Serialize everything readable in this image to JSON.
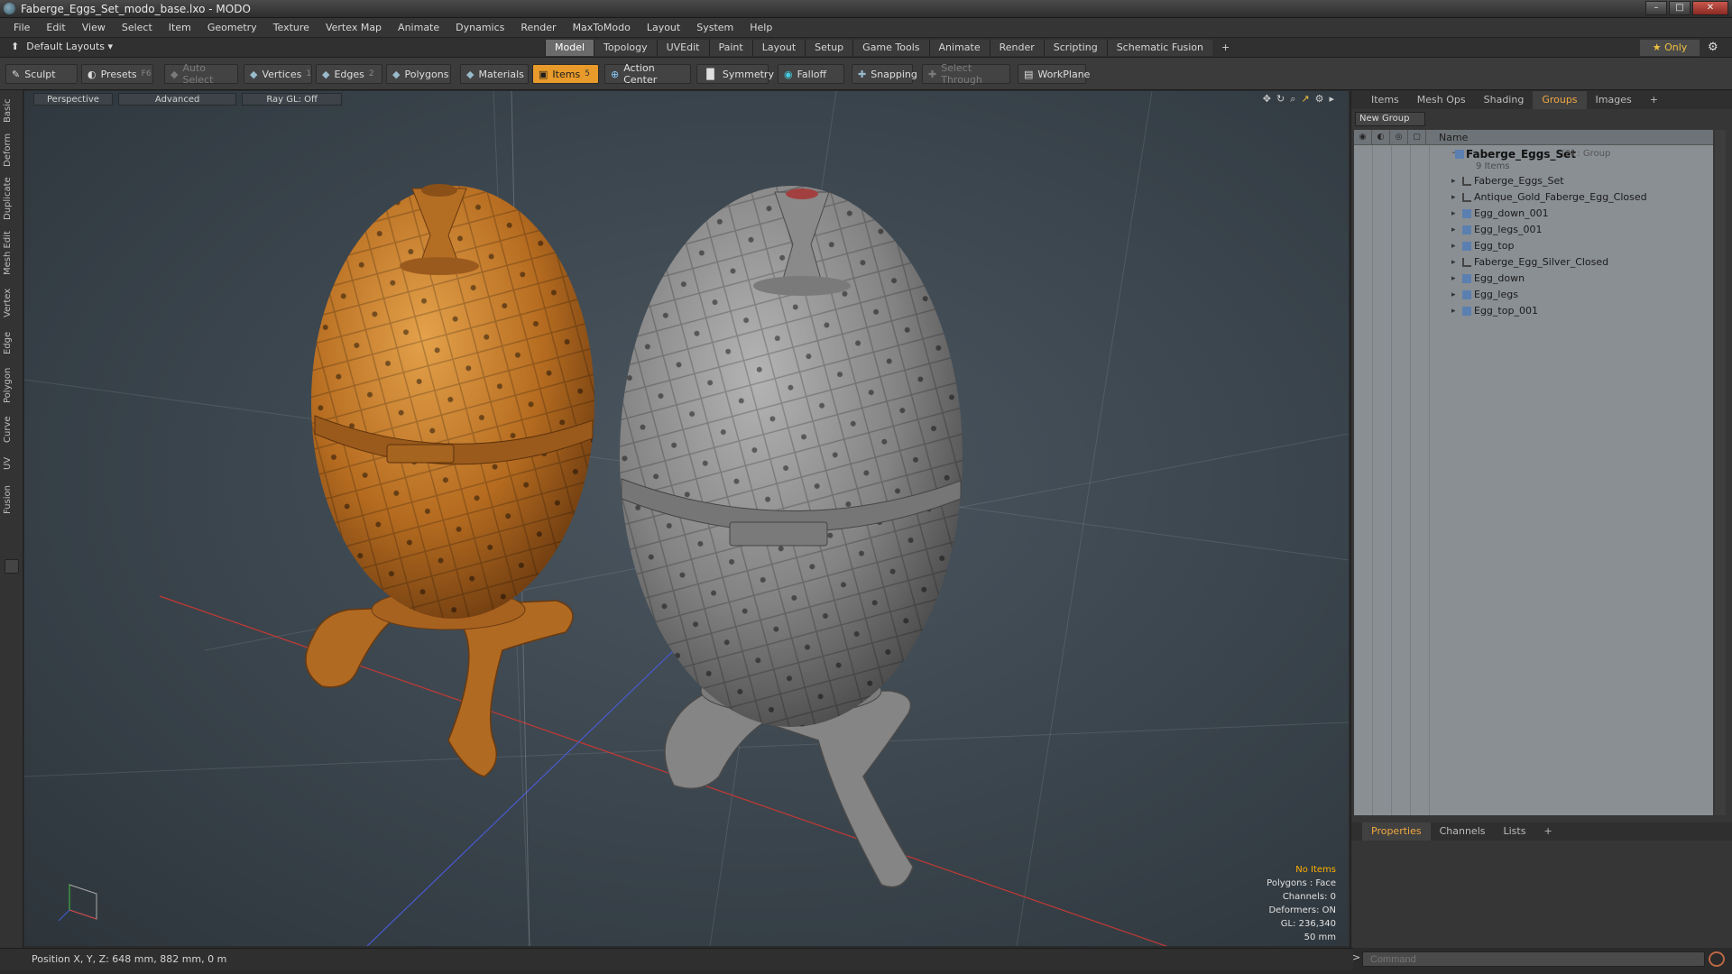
{
  "window": {
    "title": "Faberge_Eggs_Set_modo_base.lxo - MODO"
  },
  "menu": [
    "File",
    "Edit",
    "View",
    "Select",
    "Item",
    "Geometry",
    "Texture",
    "Vertex Map",
    "Animate",
    "Dynamics",
    "Render",
    "MaxToModo",
    "Layout",
    "System",
    "Help"
  ],
  "layout": {
    "selector": "Default Layouts ▾",
    "tabs": [
      "Model",
      "Topology",
      "UVEdit",
      "Paint",
      "Layout",
      "Setup",
      "Game Tools",
      "Animate",
      "Render",
      "Scripting",
      "Schematic Fusion"
    ],
    "active_tab": "Model",
    "add": "+",
    "only_label": "★ Only"
  },
  "toolbar": {
    "sculpt": "Sculpt",
    "presets": "Presets",
    "presets_key": "F6",
    "auto_select": "Auto Select",
    "vertices": "Vertices",
    "vertices_count": "1",
    "edges": "Edges",
    "edges_count": "2",
    "polygons": "Polygons",
    "materials": "Materials",
    "items": "Items",
    "items_count": "5",
    "action_center": "Action Center",
    "symmetry": "Symmetry",
    "falloff": "Falloff",
    "snapping": "Snapping",
    "select_through": "Select Through",
    "workplane": "WorkPlane"
  },
  "left_tabs": [
    "Basic",
    "Deform",
    "Duplicate",
    "Mesh Edit",
    "Vertex",
    "Edge",
    "Polygon",
    "Curve",
    "UV",
    "Fusion"
  ],
  "viewport": {
    "perspective": "Perspective",
    "advanced": "Advanced",
    "raygl": "Ray GL: Off",
    "stats": {
      "no_items": "No Items",
      "polygons": "Polygons : Face",
      "channels": "Channels: 0",
      "deformers": "Deformers: ON",
      "gl": "GL: 236,340",
      "scale": "50 mm"
    }
  },
  "status": {
    "position": "Position X, Y, Z:  648 mm, 882 mm, 0 m"
  },
  "right_panel": {
    "tabs": [
      "Items",
      "Mesh Ops",
      "Shading",
      "Groups",
      "Images",
      "+"
    ],
    "active_tab": "Groups",
    "new_group": "New Group",
    "name_col": "Name",
    "group": {
      "name": "Faberge_Eggs_Set",
      "suffix": "(2) : Group",
      "count": "9 Items"
    },
    "items": [
      {
        "name": "Faberge_Eggs_Set",
        "type": "locator"
      },
      {
        "name": "Antique_Gold_Faberge_Egg_Closed",
        "type": "locator"
      },
      {
        "name": "Egg_down_001",
        "type": "mesh"
      },
      {
        "name": "Egg_legs_001",
        "type": "mesh"
      },
      {
        "name": "Egg_top",
        "type": "mesh"
      },
      {
        "name": "Faberge_Egg_Silver_Closed",
        "type": "locator"
      },
      {
        "name": "Egg_down",
        "type": "mesh"
      },
      {
        "name": "Egg_legs",
        "type": "mesh"
      },
      {
        "name": "Egg_top_001",
        "type": "mesh"
      }
    ],
    "props_tabs": [
      "Properties",
      "Channels",
      "Lists",
      "+"
    ],
    "props_active": "Properties",
    "command_placeholder": "Command",
    "command_prompt": ">"
  },
  "colors": {
    "accent": "#e89a2a",
    "gold_egg": "#c87a2a",
    "silver_egg": "#8c8c8c"
  }
}
